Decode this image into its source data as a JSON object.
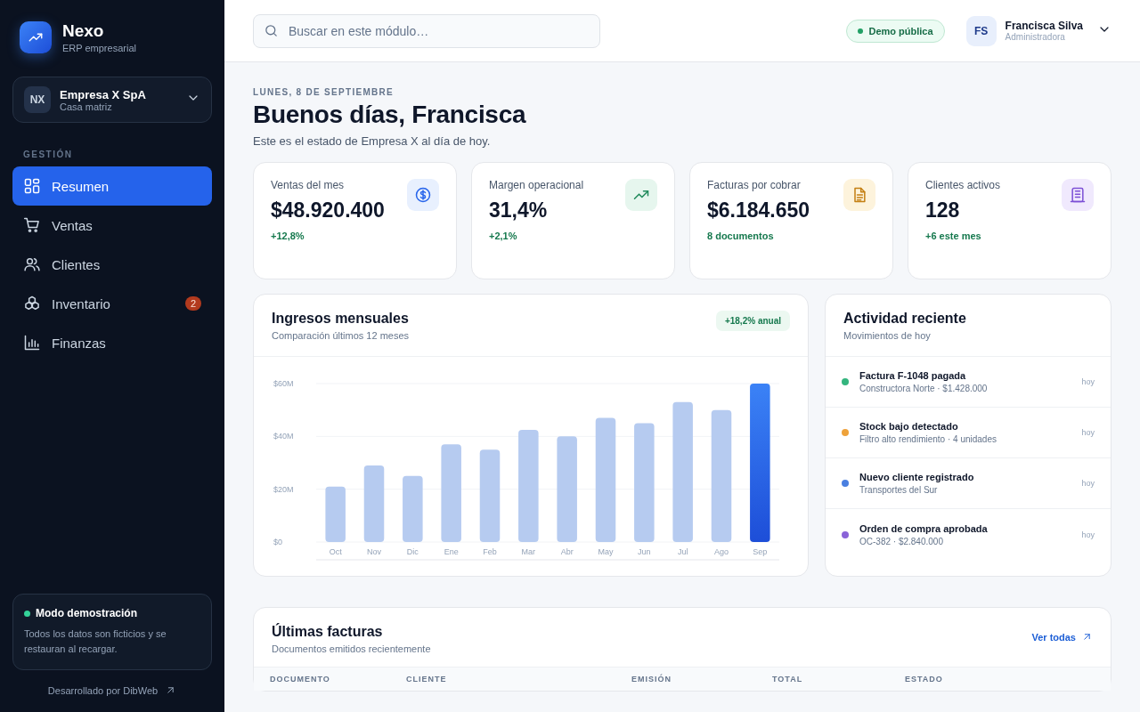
{
  "brand": {
    "name": "Nexo",
    "subtitle": "ERP empresarial"
  },
  "company": {
    "initials": "NX",
    "name": "Empresa X SpA",
    "branch": "Casa matriz"
  },
  "sidebar": {
    "section": "GESTIÓN",
    "items": [
      {
        "label": "Resumen",
        "selected": true
      },
      {
        "label": "Ventas",
        "selected": false
      },
      {
        "label": "Clientes",
        "selected": false
      },
      {
        "label": "Inventario",
        "selected": false,
        "badge": "2"
      },
      {
        "label": "Finanzas",
        "selected": false
      }
    ]
  },
  "demo_card": {
    "title": "Modo demostración",
    "text": "Todos los datos son ficticios y se restauran al recargar."
  },
  "credit": "Desarrollado por DibWeb",
  "topbar": {
    "search": {
      "placeholder": "Buscar en este módulo…"
    },
    "badge": "Demo pública",
    "user": {
      "initials": "FS",
      "name": "Francisca Silva",
      "role": "Administradora"
    }
  },
  "header": {
    "date": "LUNES, 8 DE SEPTIEMBRE",
    "title": "Buenos días, Francisca",
    "subtitle": "Este es el estado de Empresa X al día de hoy."
  },
  "kpis": [
    {
      "label": "Ventas del mes",
      "value": "$48.920.400",
      "delta": "+12,8%"
    },
    {
      "label": "Margen operacional",
      "value": "31,4%",
      "delta": "+2,1%"
    },
    {
      "label": "Facturas por cobrar",
      "value": "$6.184.650",
      "delta": "8 documentos"
    },
    {
      "label": "Clientes activos",
      "value": "128",
      "delta": "+6 este mes"
    }
  ],
  "revenue": {
    "title": "Ingresos mensuales",
    "subtitle": "Comparación últimos 12 meses",
    "badge": "+18,2% anual",
    "chart_data": {
      "type": "bar",
      "categories": [
        "Oct",
        "Nov",
        "Dic",
        "Ene",
        "Feb",
        "Mar",
        "Abr",
        "May",
        "Jun",
        "Jul",
        "Ago",
        "Sep"
      ],
      "values": [
        21,
        29,
        25,
        37,
        35,
        42.5,
        40,
        47,
        45,
        53,
        50,
        60
      ],
      "ylim": [
        0,
        60
      ],
      "yticks": [
        {
          "value": 0,
          "label": "$0"
        },
        {
          "value": 20,
          "label": "$20M"
        },
        {
          "value": 40,
          "label": "$40M"
        },
        {
          "value": 60,
          "label": "$60M"
        }
      ]
    }
  },
  "activity": {
    "title": "Actividad reciente",
    "subtitle": "Movimientos de hoy",
    "items": [
      {
        "title": "Factura F-1048 pagada",
        "detail": "Constructora Norte · $1.428.000",
        "time": "hoy",
        "color": "#34b57e"
      },
      {
        "title": "Stock bajo detectado",
        "detail": "Filtro alto rendimiento · 4 unidades",
        "time": "hoy",
        "color": "#eea23a"
      },
      {
        "title": "Nuevo cliente registrado",
        "detail": "Transportes del Sur",
        "time": "hoy",
        "color": "#4a7fe0"
      },
      {
        "title": "Orden de compra aprobada",
        "detail": "OC-382 · $2.840.000",
        "time": "hoy",
        "color": "#8a63d8"
      }
    ]
  },
  "invoices": {
    "title": "Últimas facturas",
    "subtitle": "Documentos emitidos recientemente",
    "link": "Ver todas",
    "columns": [
      "DOCUMENTO",
      "CLIENTE",
      "EMISIÓN",
      "TOTAL",
      "ESTADO"
    ]
  }
}
